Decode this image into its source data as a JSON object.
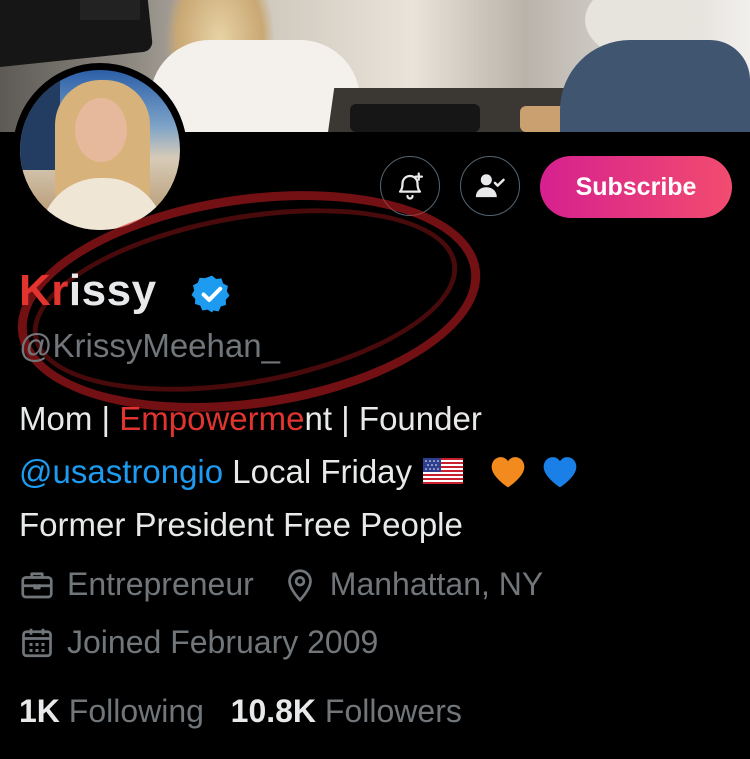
{
  "profile": {
    "name": "Krissy",
    "name_first_letters": "Kr",
    "name_rest": "issy",
    "handle": "@KrissyMeehan_",
    "bio": {
      "line1_part1": "Mom | ",
      "line1_highlight": "Empowerme",
      "line1_part2": "nt | Founder",
      "line2_mention": "@usastrongio",
      "line2_text": " Local Friday",
      "line3": "Former President Free People"
    },
    "occupation": "Entrepreneur",
    "location": "Manhattan, NY",
    "joined": "Joined February 2009",
    "following_count": "1K",
    "following_label": "Following",
    "followers_count": "10.8K",
    "followers_label": "Followers"
  },
  "actions": {
    "subscribe_label": "Subscribe"
  },
  "icons": {
    "notify": "bell-plus-icon",
    "follow": "person-check-icon",
    "verified": "verified-badge-icon",
    "occupation": "briefcase-icon",
    "location": "location-pin-icon",
    "calendar": "calendar-icon",
    "flag": "us-flag-emoji",
    "heart_orange": "orange-heart-emoji",
    "heart_blue": "blue-heart-emoji"
  },
  "colors": {
    "background": "#000000",
    "text": "#e7e9ea",
    "muted": "#71767b",
    "link": "#1d9bf0",
    "verified": "#1d9bf0",
    "annotation_red": "#e2342f",
    "subscribe_gradient_start": "#d6208f",
    "subscribe_gradient_end": "#f24c6f"
  }
}
